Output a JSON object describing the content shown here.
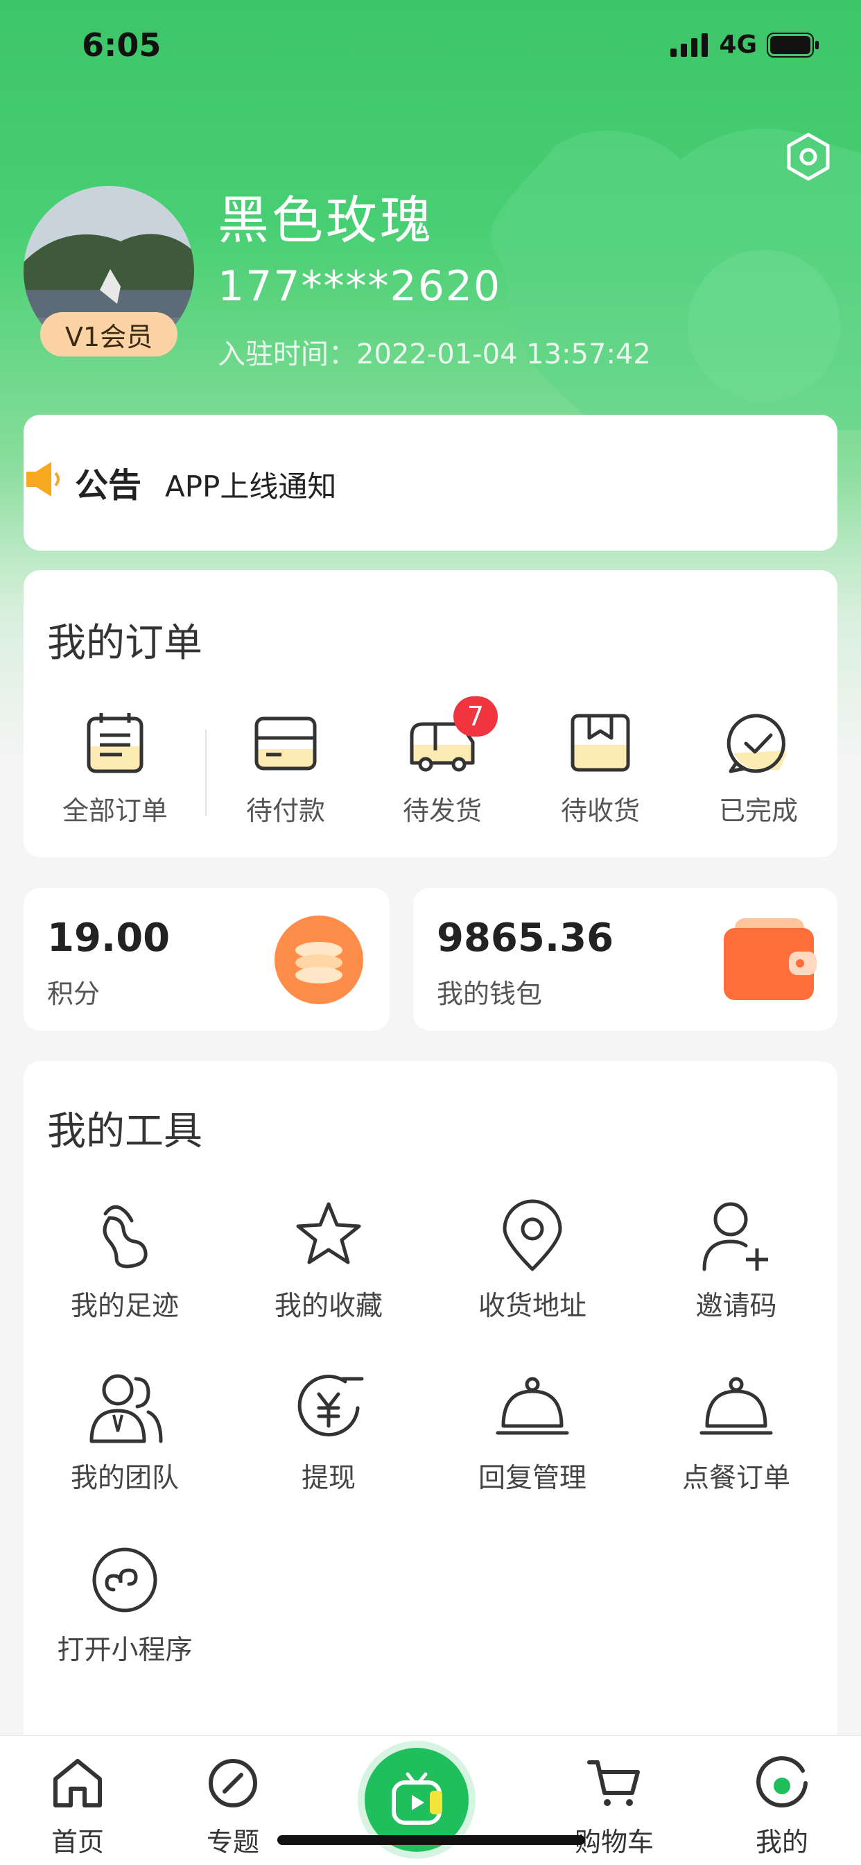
{
  "status_bar": {
    "time": "6:05",
    "network": "4G"
  },
  "profile": {
    "nickname": "黑色玫瑰",
    "phone": "177****2620",
    "join_label": "入驻时间：",
    "join_time": "2022-01-04 13:57:42",
    "vip_badge": "V1会员"
  },
  "notice": {
    "tag": "公告",
    "text": "APP上线通知"
  },
  "orders": {
    "title": "我的订单",
    "items": [
      {
        "label": "全部订单",
        "icon": "order-list-icon"
      },
      {
        "label": "待付款",
        "icon": "card-icon"
      },
      {
        "label": "待发货",
        "icon": "truck-icon",
        "badge": "7"
      },
      {
        "label": "待收货",
        "icon": "box-icon"
      },
      {
        "label": "已完成",
        "icon": "check-circle-icon"
      }
    ]
  },
  "points": {
    "value": "19.00",
    "label": "积分"
  },
  "wallet": {
    "value": "9865.36",
    "label": "我的钱包"
  },
  "tools": {
    "title": "我的工具",
    "items": [
      {
        "label": "我的足迹",
        "icon": "footprint-icon"
      },
      {
        "label": "我的收藏",
        "icon": "star-icon"
      },
      {
        "label": "收货地址",
        "icon": "location-icon"
      },
      {
        "label": "邀请码",
        "icon": "add-user-icon"
      },
      {
        "label": "我的团队",
        "icon": "team-icon"
      },
      {
        "label": "提现",
        "icon": "yuan-icon"
      },
      {
        "label": "回复管理",
        "icon": "cloche-icon"
      },
      {
        "label": "点餐订单",
        "icon": "cloche-icon"
      },
      {
        "label": "打开小程序",
        "icon": "mini-program-icon"
      }
    ]
  },
  "tabbar": {
    "items": [
      {
        "label": "首页",
        "icon": "home-icon"
      },
      {
        "label": "专题",
        "icon": "compass-icon"
      },
      {
        "label": "",
        "icon": "tv-play-icon"
      },
      {
        "label": "购物车",
        "icon": "cart-icon"
      },
      {
        "label": "我的",
        "icon": "profile-tab-icon"
      }
    ]
  },
  "colors": {
    "brand_green": "#3dc56a",
    "badge_red": "#f1353e",
    "vip_gold": "#fbd3a4"
  }
}
